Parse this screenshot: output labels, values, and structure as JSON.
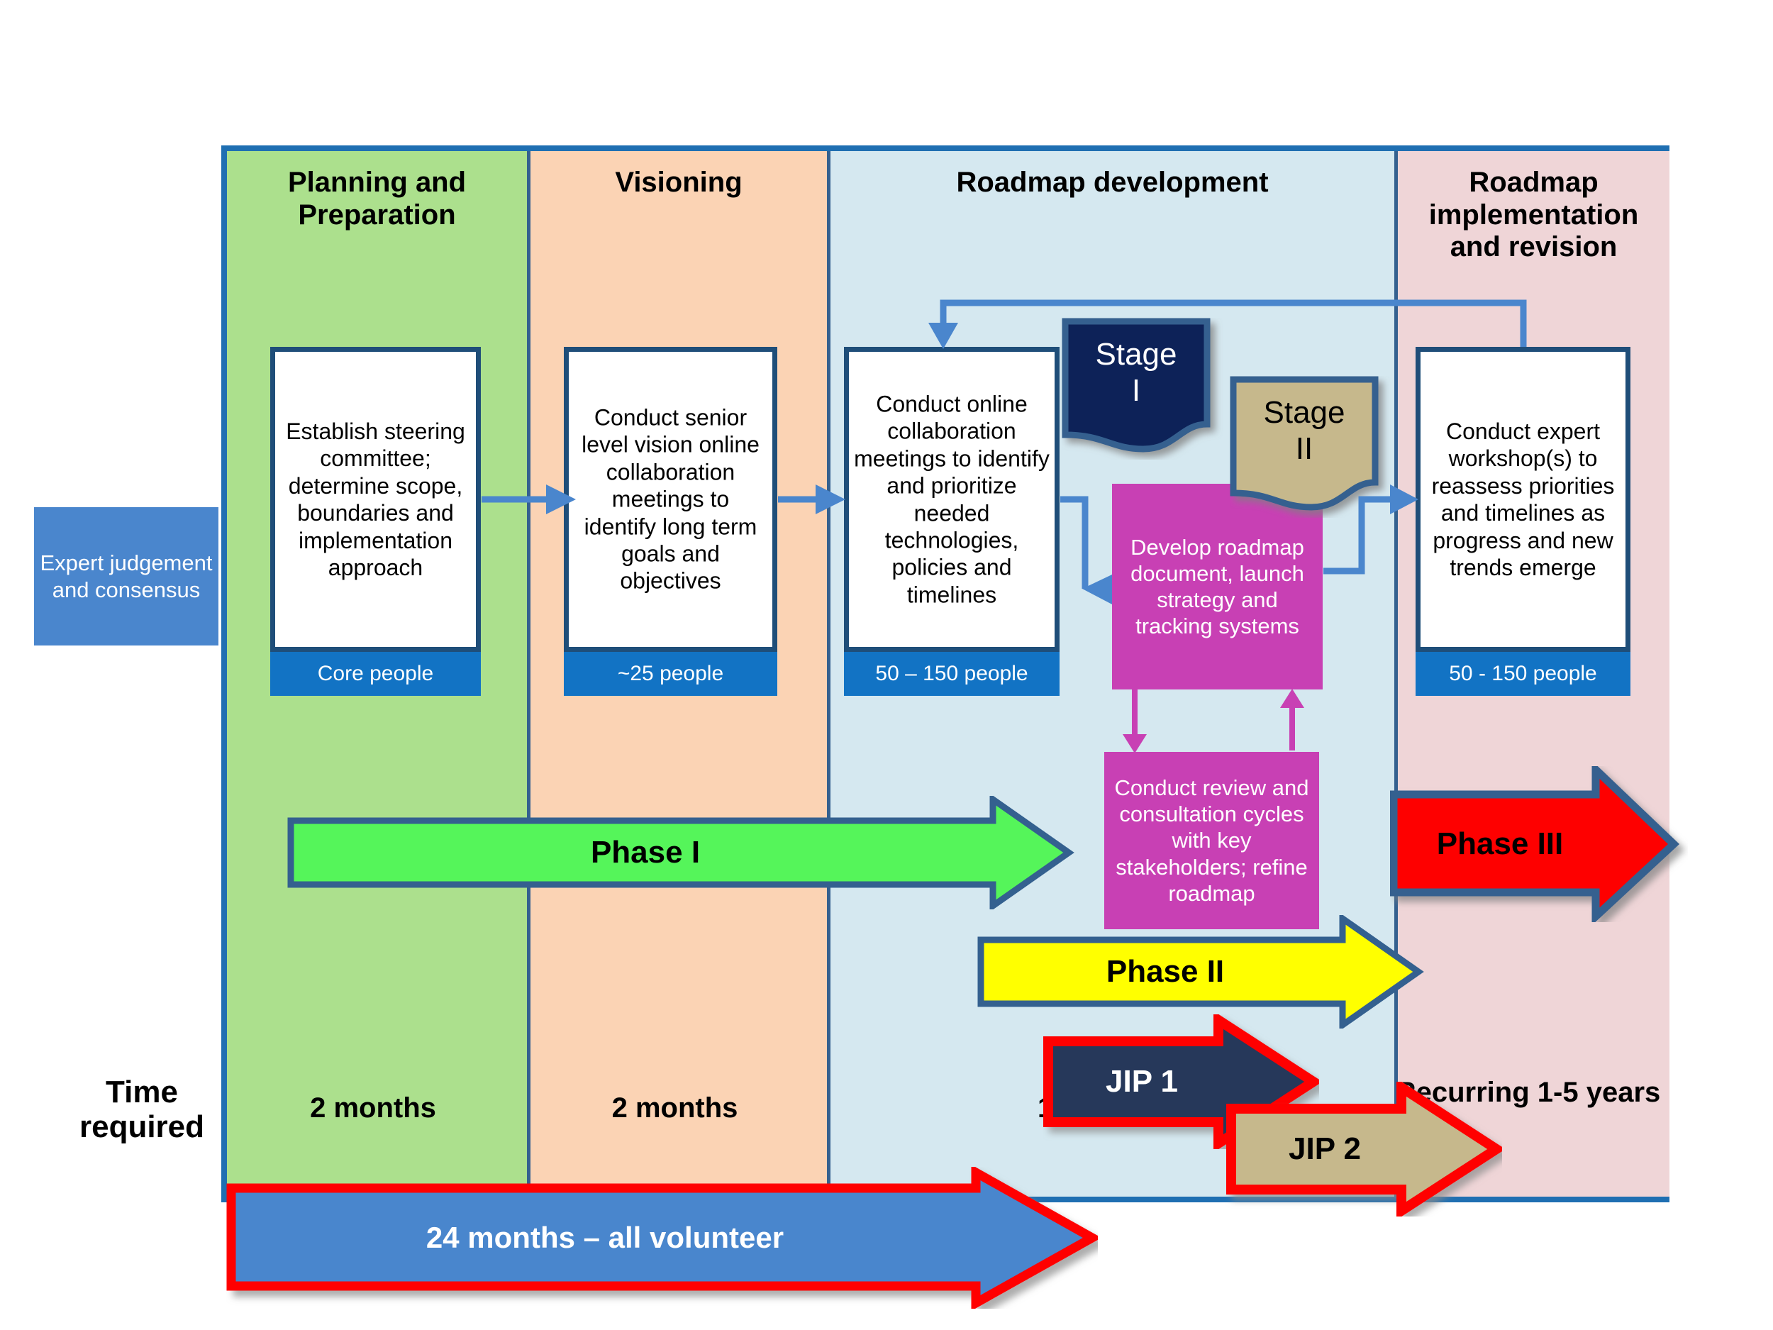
{
  "columns": [
    {
      "id": "planning",
      "title": "Planning and Preparation",
      "color": "#ace08d",
      "time": "2 months"
    },
    {
      "id": "visioning",
      "title": "Visioning",
      "color": "#fbd3b4",
      "time": "2 months"
    },
    {
      "id": "roadmap-development",
      "title": "Roadmap development",
      "color": "#d5e8f0",
      "time": "10 months"
    },
    {
      "id": "roadmap-implementation",
      "title": "Roadmap implementation and revision",
      "color": "#efd5d7",
      "time": "Recurring 1-5 years"
    }
  ],
  "process_boxes": [
    {
      "id": "establish-steering-committee",
      "text": "Establish steering committee; determine scope, boundaries and implementation approach",
      "people": "Core people"
    },
    {
      "id": "senior-level-vision",
      "text": "Conduct senior level vision online collaboration meetings to identify long term goals and objectives",
      "people": "~25 people"
    },
    {
      "id": "online-collaboration-meetings",
      "text": "Conduct online collaboration meetings to identify and prioritize needed technologies, policies and timelines",
      "people": "50 – 150 people"
    },
    {
      "id": "expert-workshops",
      "text": "Conduct expert workshop(s) to reassess priorities and timelines as progress and new trends emerge",
      "people": "50 - 150 people"
    }
  ],
  "magenta_boxes": [
    {
      "id": "develop-roadmap-document",
      "text": "Develop roadmap document, launch  strategy and tracking systems"
    },
    {
      "id": "review-consultation-cycles",
      "text": "Conduct review and consultation cycles with key stakeholders; refine roadmap"
    }
  ],
  "stages": [
    {
      "id": "stage-1",
      "line1": "Stage",
      "line2": "I",
      "fill": "#0d2259",
      "text_color": "#ffffff"
    },
    {
      "id": "stage-2",
      "line1": "Stage",
      "line2": "II",
      "fill": "#c6b88c",
      "text_color": "#000000"
    }
  ],
  "phase_arrows": [
    {
      "id": "phase-1",
      "label": "Phase I",
      "fill": "#55f55a",
      "border": "#34608f",
      "text_color": "#000000"
    },
    {
      "id": "phase-2",
      "label": "Phase II",
      "fill": "#ffff00",
      "border": "#34608f",
      "text_color": "#000000"
    },
    {
      "id": "phase-3",
      "label": "Phase III",
      "fill": "#fe0000",
      "border": "#34608f",
      "text_color": "#000000"
    }
  ],
  "jip_arrows": [
    {
      "id": "jip-1",
      "label": "JIP 1",
      "fill": "#25395a",
      "border": "#ff0000",
      "text_color": "#ffffff"
    },
    {
      "id": "jip-2",
      "label": "JIP 2",
      "fill": "#c6b88c",
      "border": "#ff0000",
      "text_color": "#000000"
    }
  ],
  "volunteer_arrow": {
    "id": "volunteer-arrow",
    "label": "24 months – all volunteer",
    "fill": "#4a86cd",
    "border": "#ff0000",
    "text_color": "#ffffff"
  },
  "side_labels": {
    "expert": "Expert judgement and consensus",
    "time_required": "Time required"
  },
  "colors": {
    "frame_border": "#1f6fb2",
    "column_divider": "#34608f",
    "box_border": "#1f4e79",
    "people_label": "#1273c4",
    "magenta": "#c840b4",
    "connector": "#4a86cd"
  }
}
